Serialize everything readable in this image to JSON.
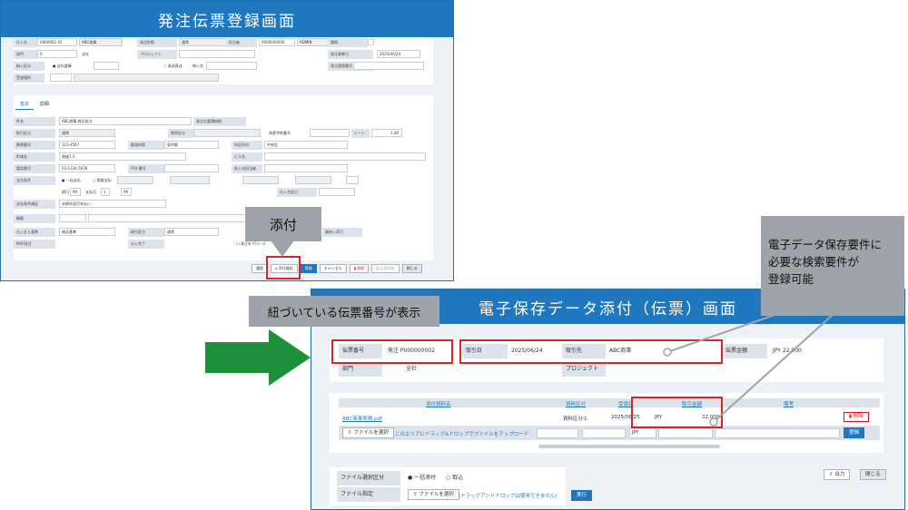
{
  "screen1": {
    "title": "発注伝票登録画面",
    "header": {
      "supplier_label": "仕入先",
      "supplier_value": "A000001-02",
      "supplier_name": "ABC商事",
      "order_type_label": "発注形態",
      "order_type_value": "通常",
      "staff_label": "担当者",
      "staff_code": "0000000000",
      "staff_name": "ADMIN",
      "tax_label": "課税",
      "dept_label": "部門",
      "dept_code": "0",
      "dept_name": "全社",
      "project_label": "プロジェクト",
      "order_date_label": "発注基準日",
      "order_date_value": "2025/06/24",
      "delivery_label": "納入区分",
      "delivery_opt1": "自社倉庫",
      "delivery_opt2": "発送直送",
      "delivery_dest_label": "納入先",
      "manage_no_label": "発注管理番号",
      "warehouse_label": "受渡場所"
    },
    "tabs": [
      "基本",
      "詳細"
    ],
    "body": {
      "subject_label": "件名",
      "subject_value": "ABC商事 商品発注",
      "trans_label": "取引区分",
      "trans_value": "通常",
      "tax_calc_label": "税率区分",
      "exchange_label": "為替予約番号",
      "rate_label": "レート",
      "rate_value": "1.00",
      "zip_label": "郵便番号",
      "zip_value": "123-4567",
      "pref_label": "都道府県",
      "pref_value": "東京都",
      "city_label": "市区町村",
      "city_value": "中央区",
      "addr_label": "町域名",
      "addr_value": "银座1-2",
      "bldg_label": "ビル名",
      "tel_label": "電話番号",
      "tel_value": "03-1234-5678",
      "fax_label": "FAX 番号",
      "contact_label": "納入先担当者",
      "pay_label": "支払条件",
      "pay_opt1": "一括支払",
      "pay_opt2": "都度支払",
      "pay_days_label": "締日",
      "pay_days_value": "99",
      "pay_month_label": "支払月",
      "pay_month_value": "1",
      "pay_day_value": "99",
      "arrival_label": "仕入予定日",
      "pay_note_label": "支払条件補足",
      "pay_note_value": "末締め翌月末払い",
      "remarks_label": "摘要",
      "base_label": "仕入計上基準",
      "base_value": "検収基準",
      "trade_label": "取引区分",
      "trade_value": "通常",
      "end_label": "仕入完了",
      "mrp_label": "MRP発注",
      "close_check_label": "発注をクローズ",
      "inspect_label": "最終入荷日"
    },
    "buttons": {
      "history": "履歴",
      "attach": "添付資料",
      "register": "登録",
      "cancel": "キャンセル",
      "delete": "削除",
      "print": "伝票印刷",
      "close": "閉じる"
    }
  },
  "callouts": {
    "attach": "添付",
    "linked_no": "紐づいている伝票番号が表示",
    "search_req_line1": "電子データ保存要件に",
    "search_req_line2": "必要な検索要件が",
    "search_req_line3": "登録可能"
  },
  "screen2": {
    "title": "電子保存データ添付（伝票）画面",
    "info": {
      "slip_no_label": "伝票番号",
      "slip_no_value": "発注 P000000002",
      "trade_date_label": "取引日",
      "trade_date_value": "2025/06/24",
      "partner_label": "取引先",
      "partner_value": "ABC商事",
      "amount_label": "伝票金額",
      "amount_value": "JPY 22,000",
      "dept_label": "部門",
      "dept_value": "全社",
      "project_label": "プロジェクト"
    },
    "table": {
      "headers": [
        "添付資料名",
        "資料区分",
        "受領日",
        "取引金額",
        "備考"
      ],
      "row": {
        "file": "ABC商事見積.pdf",
        "category": "資料区分①",
        "date": "2025/06/25",
        "currency": "JPY",
        "amount": "22,000",
        "delete": "削除"
      },
      "upload_button": "ファイルを選択",
      "upload_hint": "このエリアにドラッグ&ドロップでファイルをアップロード",
      "input_currency": "JPY",
      "add_button": "登録"
    },
    "bottom": {
      "mode_label": "ファイル選択区分",
      "mode_opt1": "一括添付",
      "mode_opt2": "取込",
      "file_label": "ファイル指定",
      "file_button": "ファイルを選択",
      "file_hint": "(ドラッグアンドドロップは使用できません)",
      "run_button": "実行",
      "export_button": "出力",
      "close_button": "閉じる"
    }
  },
  "colors": {
    "brand": "#1f77c0",
    "callout": "#9ea4a9",
    "highlight": "#d4262b",
    "arrow": "#1e8f3a"
  }
}
